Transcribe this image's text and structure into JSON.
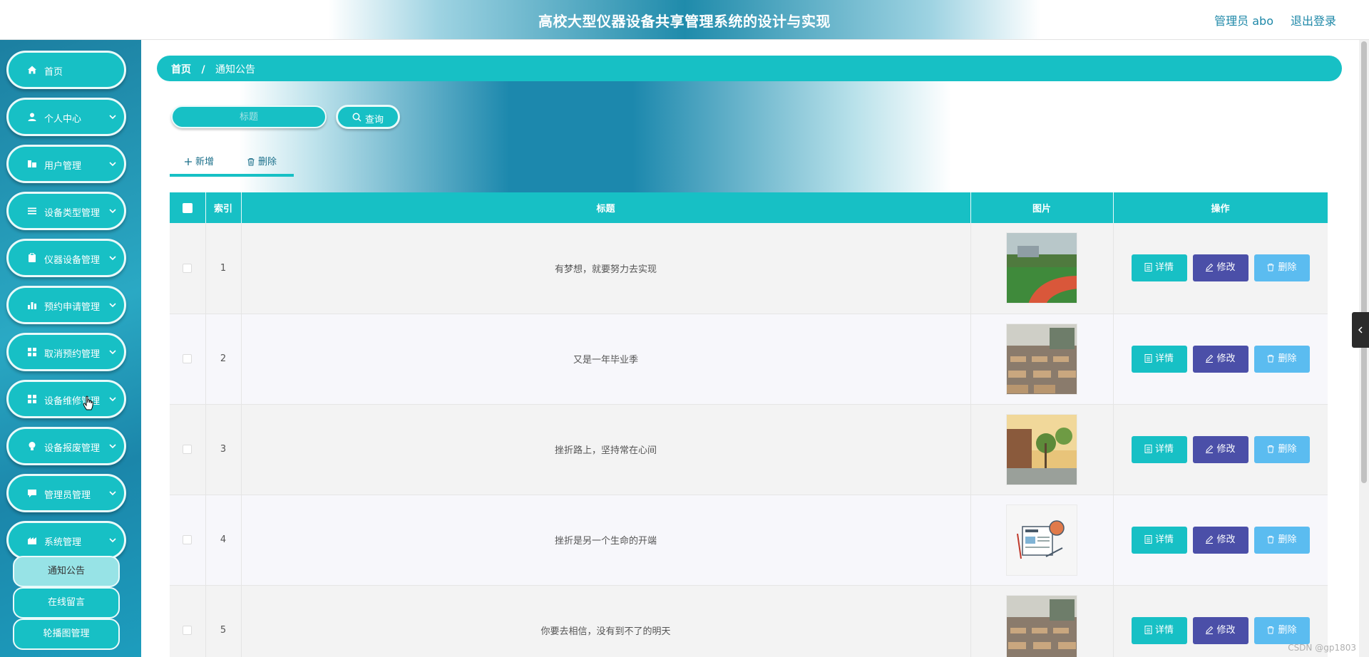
{
  "header": {
    "title": "高校大型仪器设备共享管理系统的设计与实现",
    "user": "管理员 abo",
    "logout": "退出登录"
  },
  "sidebar": {
    "items": [
      {
        "label": "首页",
        "icon": "home-icon",
        "has_arrow": false
      },
      {
        "label": "个人中心",
        "icon": "user-icon",
        "has_arrow": true
      },
      {
        "label": "用户管理",
        "icon": "users-icon",
        "has_arrow": true
      },
      {
        "label": "设备类型管理",
        "icon": "list-icon",
        "has_arrow": true
      },
      {
        "label": "仪器设备管理",
        "icon": "clipboard-icon",
        "has_arrow": true
      },
      {
        "label": "预约申请管理",
        "icon": "bar-chart-icon",
        "has_arrow": true
      },
      {
        "label": "取消预约管理",
        "icon": "grid-icon",
        "has_arrow": true
      },
      {
        "label": "设备维修管理",
        "icon": "grid-icon",
        "has_arrow": true
      },
      {
        "label": "设备报废管理",
        "icon": "bulb-icon",
        "has_arrow": true
      },
      {
        "label": "管理员管理",
        "icon": "chat-icon",
        "has_arrow": true
      },
      {
        "label": "系统管理",
        "icon": "settings-icon",
        "has_arrow": true
      }
    ],
    "submenu": [
      {
        "label": "通知公告",
        "active": true
      },
      {
        "label": "在线留言",
        "active": false
      },
      {
        "label": "轮播图管理",
        "active": false
      }
    ]
  },
  "breadcrumb": {
    "home": "首页",
    "separator": "/",
    "current": "通知公告"
  },
  "search": {
    "placeholder": "标题",
    "button": "查询"
  },
  "toolbar": {
    "add": "新增",
    "delete": "删除"
  },
  "table": {
    "headers": {
      "index": "索引",
      "title": "标题",
      "image": "图片",
      "action": "操作"
    },
    "rows": [
      {
        "index": "1",
        "title": "有梦想，就要努力去实现",
        "image": "campus-track-photo"
      },
      {
        "index": "2",
        "title": "又是一年毕业季",
        "image": "classroom-photo"
      },
      {
        "index": "3",
        "title": "挫折路上，坚持常在心间",
        "image": "campus-sunset-photo"
      },
      {
        "index": "4",
        "title": "挫折是另一个生命的开端",
        "image": "news-illustration"
      },
      {
        "index": "5",
        "title": "你要去相信，没有到不了的明天",
        "image": "classroom-photo"
      }
    ],
    "actions": {
      "detail": "详情",
      "edit": "修改",
      "delete": "删除"
    }
  },
  "watermark": "CSDN @gp1803",
  "colors": {
    "accent": "#17c0c5",
    "edit": "#4b4fa8",
    "delete": "#5bbcf0",
    "header_text": "#1e88a8"
  }
}
